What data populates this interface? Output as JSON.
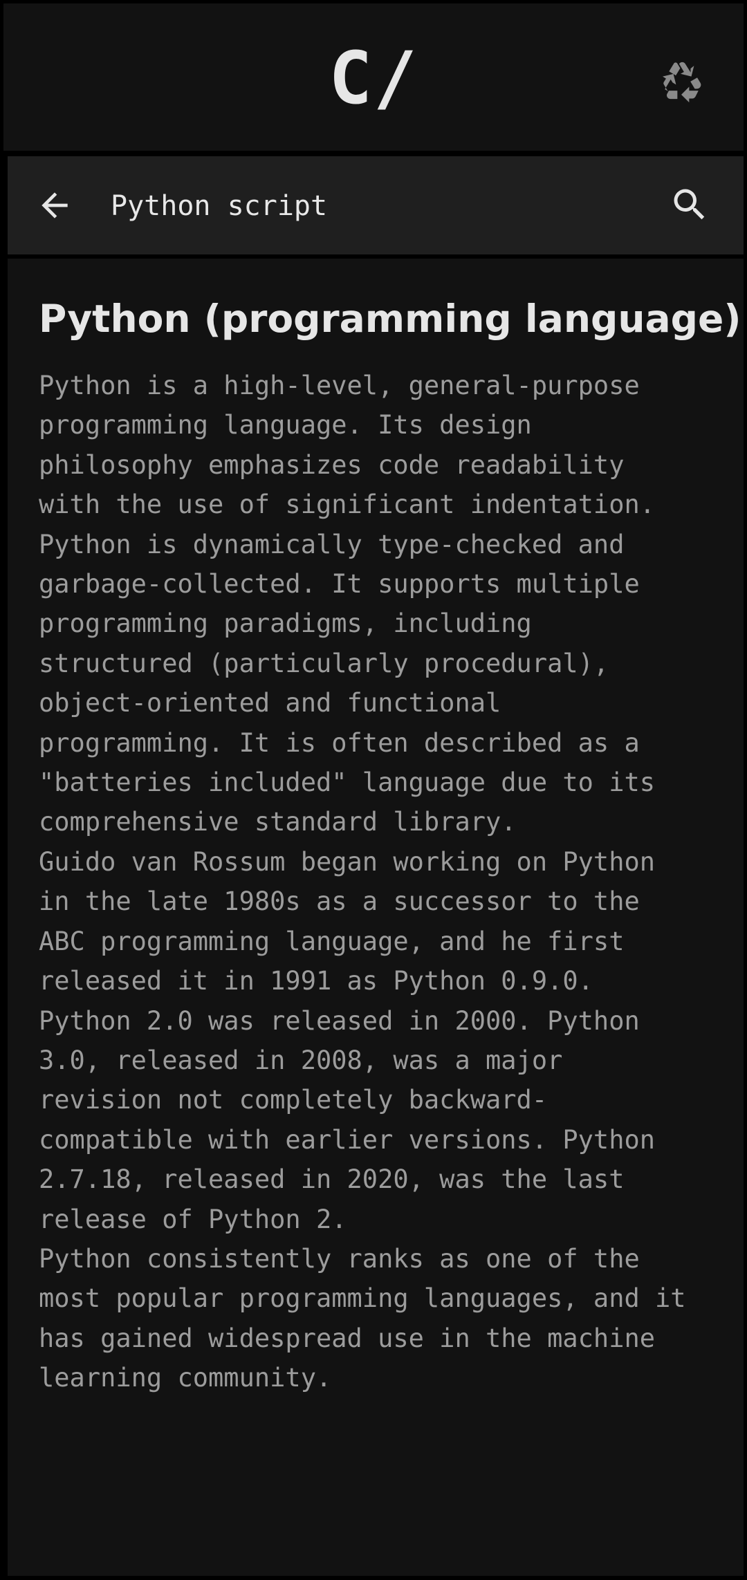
{
  "header": {
    "logo": "C/",
    "recycle_icon": "recycle-icon"
  },
  "search": {
    "back_icon": "arrow-left-icon",
    "query": "Python script",
    "search_icon": "search-icon"
  },
  "article": {
    "title": "Python (programming language)",
    "paragraphs": [
      "Python is a high-level, general-purpose\nprogramming language. Its design\nphilosophy emphasizes code readability\nwith the use of significant indentation.\nPython is dynamically type-checked and\ngarbage-collected. It supports multiple\nprogramming paradigms, including\nstructured (particularly procedural),\nobject-oriented and functional\nprogramming. It is often described as a\n\"batteries included\" language due to its\ncomprehensive standard library.",
      "Guido van Rossum began working on Python\nin the late 1980s as a successor to the\nABC programming language, and he first\nreleased it in 1991 as Python 0.9.0.\nPython 2.0 was released in 2000. Python\n3.0, released in 2008, was a major\nrevision not completely backward-\ncompatible with earlier versions. Python\n2.7.18, released in 2020, was the last\nrelease of Python 2.",
      "Python consistently ranks as one of the\nmost popular programming languages, and it\nhas gained widespread use in the machine\nlearning community."
    ]
  },
  "colors": {
    "page_background": "#000000",
    "panel_background": "#121212",
    "search_bar_background": "#1f1f1f",
    "title_text": "#e6e6e6",
    "body_text": "#9c9c9c",
    "icon": "#e6e6e6",
    "logo_icon": "#8a8a8a"
  }
}
